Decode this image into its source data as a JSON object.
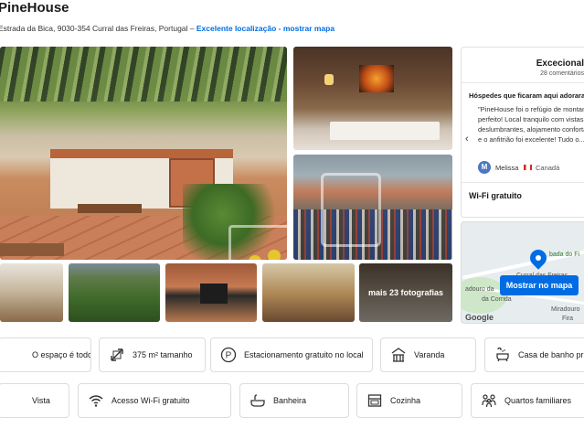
{
  "header": {
    "title": "PineHouse",
    "address": "Estrada da Bica, 9030-354 Curral das Freiras, Portugal –",
    "location_link": "Excelente localização - mostrar mapa"
  },
  "gallery": {
    "more_photos": "mais 23 fotografias"
  },
  "review_card": {
    "score_label": "Excecional",
    "review_count": "28 comentários",
    "liked_heading": "Hóspedes que ficaram aqui adoraram",
    "quote": "\"PineHouse foi o refúgio de montanha perfeito! Local tranquilo com vistas deslumbrantes, alojamento confortável e o anfitrião foi excelente! Tudo o...\"",
    "reviewer_initial": "M",
    "reviewer_name": "Melissa",
    "reviewer_country": "Canadá",
    "wifi_label": "Wi-Fi gratuito"
  },
  "map": {
    "button_label": "Mostrar no mapa",
    "labels": [
      "badа do Fi",
      "Curral das Freiras",
      "adouro da",
      "da Corrida",
      "Miradouro",
      "Fira"
    ],
    "google": "Google"
  },
  "amenities": [
    {
      "label": "O espaço é todo seu",
      "icon": "house-icon"
    },
    {
      "label": "375 m² tamanho",
      "icon": "size-icon"
    },
    {
      "label": "Estacionamento gratuito no local",
      "icon": "parking-icon"
    },
    {
      "label": "Varanda",
      "icon": "balcony-icon"
    },
    {
      "label": "Casa de banho privada",
      "icon": "bath-icon"
    },
    {
      "label": "Vista",
      "icon": "view-icon"
    },
    {
      "label": "Acesso Wi-Fi gratuito",
      "icon": "wifi-icon"
    },
    {
      "label": "Banheira",
      "icon": "bathtub-icon"
    },
    {
      "label": "Cozinha",
      "icon": "kitchen-icon"
    },
    {
      "label": "Quartos familiares",
      "icon": "family-icon"
    }
  ],
  "colors": {
    "accent": "#006ce4",
    "text": "#1a1a1a",
    "border": "#dcdcdc"
  }
}
